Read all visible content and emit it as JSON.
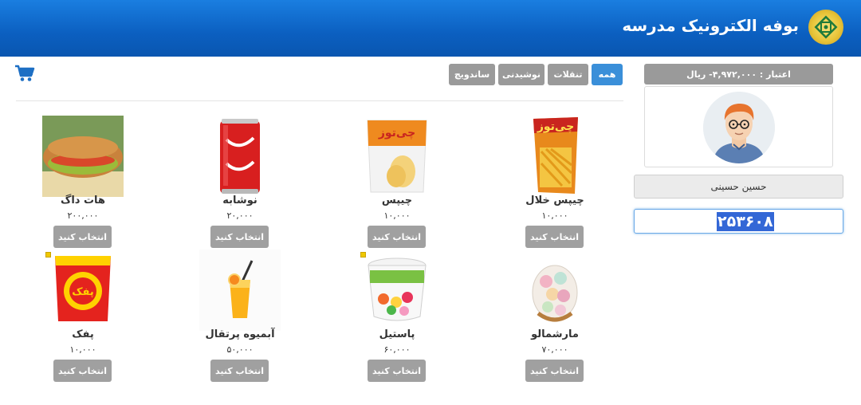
{
  "header": {
    "title": "بوفه الکترونیک مدرسه",
    "logo_icon": "school-emblem-icon"
  },
  "cart": {
    "icon": "cart-icon",
    "color": "#1d6fc4"
  },
  "tabs": [
    {
      "label": "همه",
      "active": true
    },
    {
      "label": "تنقلات",
      "active": false
    },
    {
      "label": "نوشیدنی",
      "active": false
    },
    {
      "label": "ساندویچ",
      "active": false
    }
  ],
  "sidebar": {
    "credit": "اعتبار : ۴,۹۷۲,۰۰۰- ریال",
    "avatar_icon": "user-avatar-icon",
    "user_name": "حسین حسینی",
    "code_value": "۲۵۳۶۰۸"
  },
  "products": [
    {
      "name": "چیپس خلال",
      "price": "۱۰,۰۰۰",
      "button": "انتخاب کنید",
      "icon": "chips-stick-icon"
    },
    {
      "name": "چیپس",
      "price": "۱۰,۰۰۰",
      "button": "انتخاب کنید",
      "icon": "chips-bag-icon"
    },
    {
      "name": "نوشابه",
      "price": "۲۰,۰۰۰",
      "button": "انتخاب کنید",
      "icon": "soda-can-icon"
    },
    {
      "name": "هات داگ",
      "price": "۲۰۰,۰۰۰",
      "button": "انتخاب کنید",
      "icon": "hotdog-sandwich-icon"
    },
    {
      "name": "مارشمالو",
      "price": "۷۰,۰۰۰",
      "button": "انتخاب کنید",
      "icon": "marshmallow-basket-icon"
    },
    {
      "name": "پاستیل",
      "price": "۶۰,۰۰۰",
      "button": "انتخاب کنید",
      "icon": "gummy-tub-icon"
    },
    {
      "name": "آبمیوه پرتقال",
      "price": "۵۰,۰۰۰",
      "button": "انتخاب کنید",
      "icon": "orange-juice-icon"
    },
    {
      "name": "پفک",
      "price": "۱۰,۰۰۰",
      "button": "انتخاب کنید",
      "icon": "puffs-bag-icon"
    }
  ],
  "colors": {
    "header_blue": "#0b5fc0",
    "active_tab": "#3a8fd9",
    "button_gray": "#a0a0a0"
  }
}
